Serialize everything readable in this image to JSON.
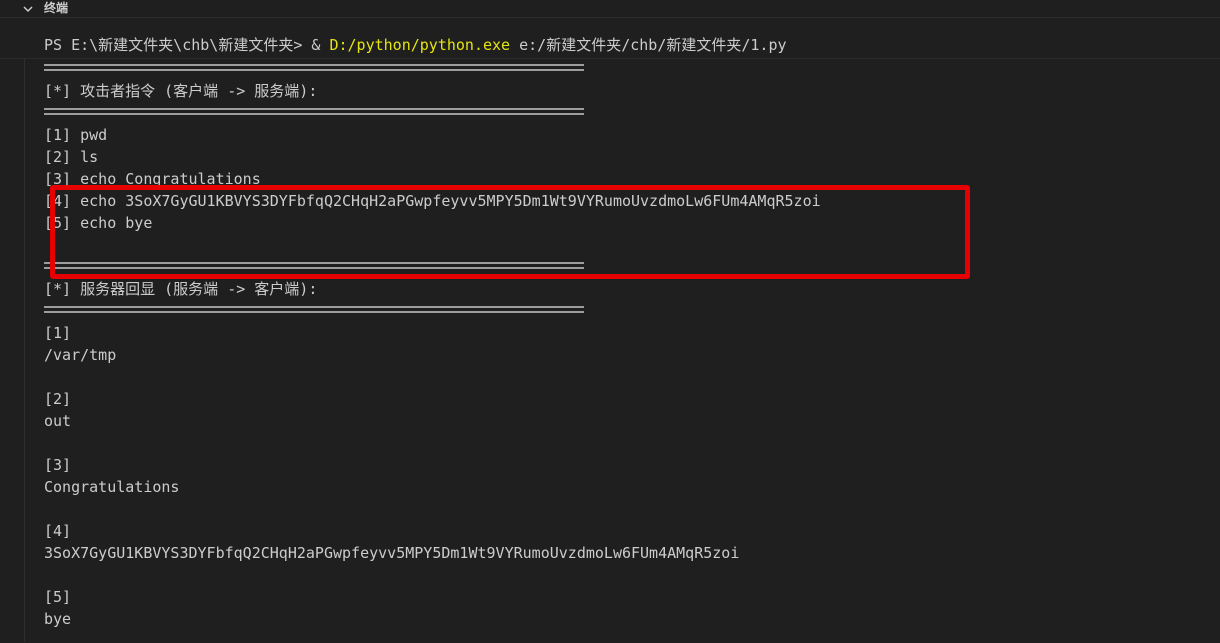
{
  "panel": {
    "title": "终端",
    "toggle_icon": "chevron-down-icon"
  },
  "prompt": {
    "ps_prefix": "PS E:\\新建文件夹\\chb\\新建文件夹> & ",
    "executable": "D:/python/python.exe",
    "script_arg": " e:/新建文件夹/chb/新建文件夹/1.py"
  },
  "separator": "============================================================",
  "attacker_section": {
    "heading": "[*] 攻击者指令 (客户端 -> 服务端):",
    "commands": [
      "[1] pwd",
      "[2] ls",
      "[3] echo Congratulations",
      "[4] echo 3SoX7GyGU1KBVYS3DYFbfqQ2CHqH2aPGwpfeyvv5MPY5Dm1Wt9VYRumoUvzdmoLw6FUm4AMqR5zoi",
      "[5] echo bye"
    ]
  },
  "server_section": {
    "heading": "[*] 服务器回显 (服务端 -> 客户端):",
    "responses": [
      {
        "index": "[1]",
        "output": "/var/tmp"
      },
      {
        "index": "[2]",
        "output": "out"
      },
      {
        "index": "[3]",
        "output": "Congratulations"
      },
      {
        "index": "[4]",
        "output": "3SoX7GyGU1KBVYS3DYFbfqQ2CHqH2aPGwpfeyvv5MPY5Dm1Wt9VYRumoUvzdmoLw6FUm4AMqR5zoi"
      },
      {
        "index": "[5]",
        "output": "bye"
      }
    ]
  },
  "colors": {
    "background": "#1f1f1f",
    "text": "#cccccc",
    "command_highlight": "#e5e510",
    "annotation_red": "#e60000"
  }
}
